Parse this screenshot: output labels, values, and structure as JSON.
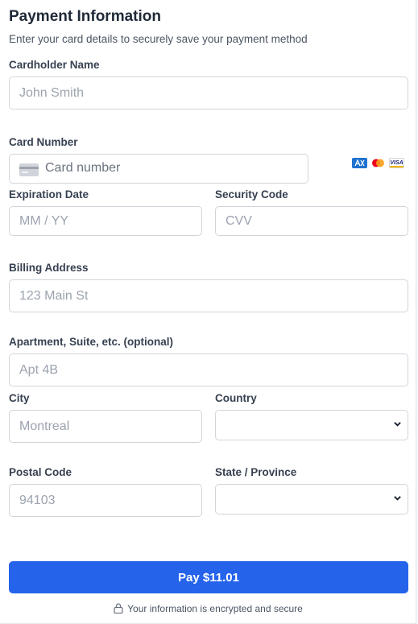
{
  "header": {
    "title": "Payment Information",
    "subtitle": "Enter your card details to securely save your payment method"
  },
  "fields": {
    "cardholder": {
      "label": "Cardholder Name",
      "placeholder": "John Smith"
    },
    "card_number": {
      "label": "Card Number",
      "placeholder": "Card number",
      "icon": "credit-card-icon"
    },
    "expiration": {
      "label": "Expiration Date",
      "placeholder": "MM / YY"
    },
    "security_code": {
      "label": "Security Code",
      "placeholder": "CVV"
    },
    "billing_address": {
      "label": "Billing Address",
      "placeholder": "123 Main St"
    },
    "apartment": {
      "label": "Apartment, Suite, etc. (optional)",
      "placeholder": "Apt 4B"
    },
    "city": {
      "label": "City",
      "placeholder": "Montreal"
    },
    "country": {
      "label": "Country",
      "value": ""
    },
    "postal_code": {
      "label": "Postal Code",
      "placeholder": "94103"
    },
    "state": {
      "label": "State / Province",
      "value": ""
    }
  },
  "card_brands": [
    "amex",
    "mastercard",
    "visa"
  ],
  "visa_text": "VISA",
  "pay_button": {
    "label": "Pay $11.01"
  },
  "footer": {
    "secure_text": "Your information is encrypted and secure",
    "icon": "lock-icon"
  },
  "colors": {
    "accent": "#2563eb",
    "border": "#d1d5db",
    "placeholder": "#9ca3af"
  }
}
